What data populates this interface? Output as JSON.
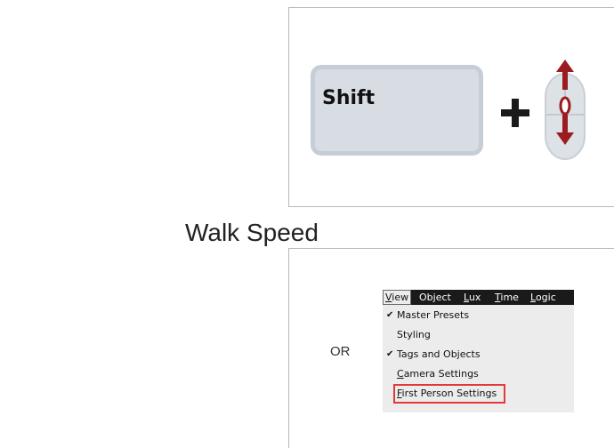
{
  "page": {
    "title": "Walk Speed"
  },
  "keyboard_shortcut": {
    "key_label": "Shift",
    "plus_icon": "plus-icon",
    "mouse_icon": "mouse-scroll-wheel-icon",
    "colors": {
      "key_fill": "#d7dde3",
      "key_border": "#c5ced6",
      "mouse_body": "#dde2e6",
      "arrow_red": "#9b1c1f",
      "plus": "#1a1a1a"
    }
  },
  "alternative": {
    "or_label": "OR"
  },
  "menu": {
    "bar_items": [
      {
        "label": "View",
        "mnemonic": "V",
        "rest": "iew",
        "active": true
      },
      {
        "label": "Object",
        "mnemonic": "",
        "rest": "Object",
        "active": false
      },
      {
        "label": "Lux",
        "mnemonic": "L",
        "rest": "ux",
        "active": false
      },
      {
        "label": "Time",
        "mnemonic": "T",
        "rest": "ime",
        "active": false
      },
      {
        "label": "Logic",
        "mnemonic": "L",
        "rest": "ogic",
        "active": false
      }
    ],
    "items": [
      {
        "label": "Master Presets",
        "checked": true,
        "check_glyph": "✔",
        "mnemonic": "",
        "rest": "Master Presets"
      },
      {
        "label": "Styling",
        "checked": false,
        "check_glyph": "",
        "mnemonic": "",
        "rest": "Styling"
      },
      {
        "label": "Tags and Objects",
        "checked": true,
        "check_glyph": "✔",
        "mnemonic": "",
        "rest": "Tags and Objects"
      },
      {
        "label": "Camera Settings",
        "checked": false,
        "check_glyph": "",
        "mnemonic": "C",
        "rest": "amera Settings"
      },
      {
        "label": "First Person Settings",
        "checked": false,
        "check_glyph": "",
        "mnemonic": "F",
        "rest": "irst Person Settings",
        "highlighted": true
      }
    ],
    "highlight_color": "#e23a3a"
  }
}
